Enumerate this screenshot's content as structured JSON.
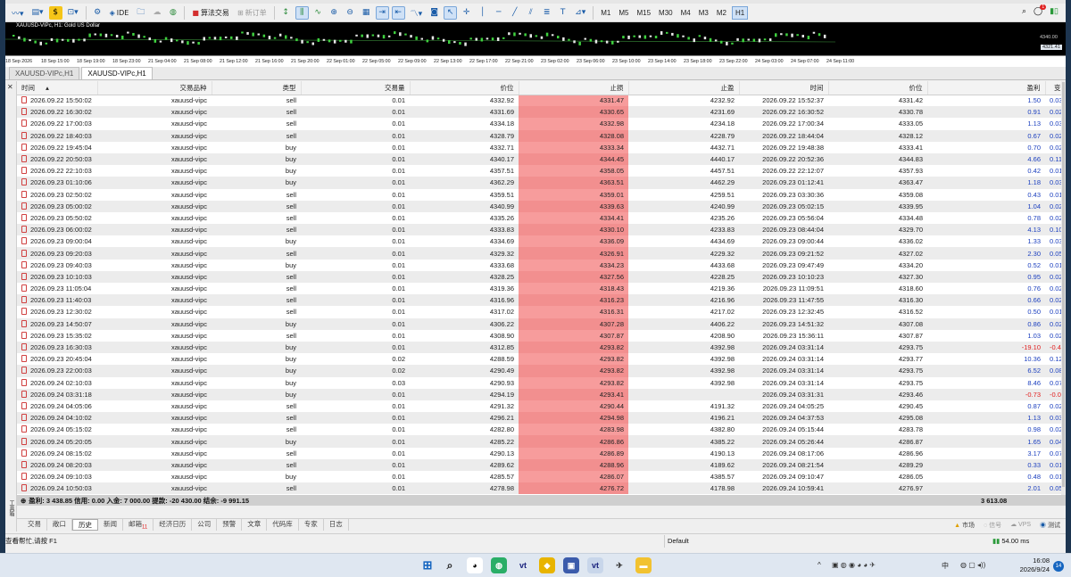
{
  "toolbar": {
    "algo_trading_label": "算法交易",
    "new_order_label": "新订单",
    "ide_label": "IDE",
    "timeframes": [
      "M1",
      "M5",
      "M15",
      "M30",
      "M4",
      "M3",
      "M2",
      "H1"
    ],
    "active_timeframe": "H1",
    "notification_count": "1"
  },
  "chart": {
    "title": "XAUUSD-VIPc, H1:  Gold US Dollar",
    "price_top": "4340.00",
    "price_tag": "4321.41",
    "time_labels": [
      "18 Sep 2026",
      "18 Sep 15:00",
      "18 Sep 19:00",
      "18 Sep 23:00",
      "21 Sep 04:00",
      "21 Sep 08:00",
      "21 Sep 12:00",
      "21 Sep 16:00",
      "21 Sep 20:00",
      "22 Sep 01:00",
      "22 Sep 05:00",
      "22 Sep 09:00",
      "22 Sep 13:00",
      "22 Sep 17:00",
      "22 Sep 21:00",
      "23 Sep 02:00",
      "23 Sep 06:00",
      "23 Sep 10:00",
      "23 Sep 14:00",
      "23 Sep 18:00",
      "23 Sep 22:00",
      "24 Sep 03:00",
      "24 Sep 07:00",
      "24 Sep 11:00"
    ]
  },
  "chart_tabs": [
    "XAUUSD-VIPc,H1",
    "XAUUSD-VIPc,H1"
  ],
  "terminal_label": "工具箱",
  "history": {
    "columns": [
      "时间",
      "交易品种",
      "类型",
      "交易量",
      "价位",
      "止损",
      "止盈",
      "时间",
      "价位",
      "盈利",
      "变"
    ],
    "rows": [
      [
        "2026.09.22 15:50:02",
        "xauusd-vipc",
        "sell",
        "0.01",
        "4332.92",
        "4331.47",
        "4232.92",
        "2026.09.22 15:52:37",
        "4331.42",
        "1.50",
        "0.03"
      ],
      [
        "2026.09.22 16:30:02",
        "xauusd-vipc",
        "sell",
        "0.01",
        "4331.69",
        "4330.65",
        "4231.69",
        "2026.09.22 16:30:52",
        "4330.78",
        "0.91",
        "0.02"
      ],
      [
        "2026.09.22 17:00:03",
        "xauusd-vipc",
        "sell",
        "0.01",
        "4334.18",
        "4332.98",
        "4234.18",
        "2026.09.22 17:00:34",
        "4333.05",
        "1.13",
        "0.03"
      ],
      [
        "2026.09.22 18:40:03",
        "xauusd-vipc",
        "sell",
        "0.01",
        "4328.79",
        "4328.08",
        "4228.79",
        "2026.09.22 18:44:04",
        "4328.12",
        "0.67",
        "0.02"
      ],
      [
        "2026.09.22 19:45:04",
        "xauusd-vipc",
        "buy",
        "0.01",
        "4332.71",
        "4333.34",
        "4432.71",
        "2026.09.22 19:48:38",
        "4333.41",
        "0.70",
        "0.02"
      ],
      [
        "2026.09.22 20:50:03",
        "xauusd-vipc",
        "buy",
        "0.01",
        "4340.17",
        "4344.45",
        "4440.17",
        "2026.09.22 20:52:36",
        "4344.83",
        "4.66",
        "0.11"
      ],
      [
        "2026.09.22 22:10:03",
        "xauusd-vipc",
        "buy",
        "0.01",
        "4357.51",
        "4358.05",
        "4457.51",
        "2026.09.22 22:12:07",
        "4357.93",
        "0.42",
        "0.01"
      ],
      [
        "2026.09.23 01:10:06",
        "xauusd-vipc",
        "buy",
        "0.01",
        "4362.29",
        "4363.51",
        "4462.29",
        "2026.09.23 01:12:41",
        "4363.47",
        "1.18",
        "0.03"
      ],
      [
        "2026.09.23 02:50:02",
        "xauusd-vipc",
        "sell",
        "0.01",
        "4359.51",
        "4359.01",
        "4259.51",
        "2026.09.23 03:30:36",
        "4359.08",
        "0.43",
        "0.01"
      ],
      [
        "2026.09.23 05:00:02",
        "xauusd-vipc",
        "sell",
        "0.01",
        "4340.99",
        "4339.63",
        "4240.99",
        "2026.09.23 05:02:15",
        "4339.95",
        "1.04",
        "0.02"
      ],
      [
        "2026.09.23 05:50:02",
        "xauusd-vipc",
        "sell",
        "0.01",
        "4335.26",
        "4334.41",
        "4235.26",
        "2026.09.23 05:56:04",
        "4334.48",
        "0.78",
        "0.02"
      ],
      [
        "2026.09.23 06:00:02",
        "xauusd-vipc",
        "sell",
        "0.01",
        "4333.83",
        "4330.10",
        "4233.83",
        "2026.09.23 08:44:04",
        "4329.70",
        "4.13",
        "0.10"
      ],
      [
        "2026.09.23 09:00:04",
        "xauusd-vipc",
        "buy",
        "0.01",
        "4334.69",
        "4336.09",
        "4434.69",
        "2026.09.23 09:00:44",
        "4336.02",
        "1.33",
        "0.03"
      ],
      [
        "2026.09.23 09:20:03",
        "xauusd-vipc",
        "sell",
        "0.01",
        "4329.32",
        "4326.91",
        "4229.32",
        "2026.09.23 09:21:52",
        "4327.02",
        "2.30",
        "0.05"
      ],
      [
        "2026.09.23 09:40:03",
        "xauusd-vipc",
        "buy",
        "0.01",
        "4333.68",
        "4334.23",
        "4433.68",
        "2026.09.23 09:47:49",
        "4334.20",
        "0.52",
        "0.01"
      ],
      [
        "2026.09.23 10:10:03",
        "xauusd-vipc",
        "sell",
        "0.01",
        "4328.25",
        "4327.56",
        "4228.25",
        "2026.09.23 10:10:23",
        "4327.30",
        "0.95",
        "0.02"
      ],
      [
        "2026.09.23 11:05:04",
        "xauusd-vipc",
        "sell",
        "0.01",
        "4319.36",
        "4318.43",
        "4219.36",
        "2026.09.23 11:09:51",
        "4318.60",
        "0.76",
        "0.02"
      ],
      [
        "2026.09.23 11:40:03",
        "xauusd-vipc",
        "sell",
        "0.01",
        "4316.96",
        "4316.23",
        "4216.96",
        "2026.09.23 11:47:55",
        "4316.30",
        "0.66",
        "0.02"
      ],
      [
        "2026.09.23 12:30:02",
        "xauusd-vipc",
        "sell",
        "0.01",
        "4317.02",
        "4316.31",
        "4217.02",
        "2026.09.23 12:32:45",
        "4316.52",
        "0.50",
        "0.01"
      ],
      [
        "2026.09.23 14:50:07",
        "xauusd-vipc",
        "buy",
        "0.01",
        "4306.22",
        "4307.28",
        "4406.22",
        "2026.09.23 14:51:32",
        "4307.08",
        "0.86",
        "0.02"
      ],
      [
        "2026.09.23 15:35:02",
        "xauusd-vipc",
        "sell",
        "0.01",
        "4308.90",
        "4307.87",
        "4208.90",
        "2026.09.23 15:36:11",
        "4307.87",
        "1.03",
        "0.02"
      ],
      [
        "2026.09.23 16:30:03",
        "xauusd-vipc",
        "buy",
        "0.01",
        "4312.85",
        "4293.82",
        "4392.98",
        "2026.09.24 03:31:14",
        "4293.75",
        "-19.10",
        "-0.44"
      ],
      [
        "2026.09.23 20:45:04",
        "xauusd-vipc",
        "buy",
        "0.02",
        "4288.59",
        "4293.82",
        "4392.98",
        "2026.09.24 03:31:14",
        "4293.77",
        "10.36",
        "0.12"
      ],
      [
        "2026.09.23 22:00:03",
        "xauusd-vipc",
        "buy",
        "0.02",
        "4290.49",
        "4293.82",
        "4392.98",
        "2026.09.24 03:31:14",
        "4293.75",
        "6.52",
        "0.08"
      ],
      [
        "2026.09.24 02:10:03",
        "xauusd-vipc",
        "buy",
        "0.03",
        "4290.93",
        "4293.82",
        "4392.98",
        "2026.09.24 03:31:14",
        "4293.75",
        "8.46",
        "0.07"
      ],
      [
        "2026.09.24 03:31:18",
        "xauusd-vipc",
        "buy",
        "0.01",
        "4294.19",
        "4293.41",
        "",
        "2026.09.24 03:31:31",
        "4293.46",
        "-0.73",
        "-0.02"
      ],
      [
        "2026.09.24 04:05:06",
        "xauusd-vipc",
        "sell",
        "0.01",
        "4291.32",
        "4290.44",
        "4191.32",
        "2026.09.24 04:05:25",
        "4290.45",
        "0.87",
        "0.02"
      ],
      [
        "2026.09.24 04:10:02",
        "xauusd-vipc",
        "sell",
        "0.01",
        "4296.21",
        "4294.98",
        "4196.21",
        "2026.09.24 04:37:53",
        "4295.08",
        "1.13",
        "0.03"
      ],
      [
        "2026.09.24 05:15:02",
        "xauusd-vipc",
        "sell",
        "0.01",
        "4282.80",
        "4283.98",
        "4382.80",
        "2026.09.24 05:15:44",
        "4283.78",
        "0.98",
        "0.02"
      ],
      [
        "2026.09.24 05:20:05",
        "xauusd-vipc",
        "buy",
        "0.01",
        "4285.22",
        "4286.86",
        "4385.22",
        "2026.09.24 05:26:44",
        "4286.87",
        "1.65",
        "0.04"
      ],
      [
        "2026.09.24 08:15:02",
        "xauusd-vipc",
        "sell",
        "0.01",
        "4290.13",
        "4286.89",
        "4190.13",
        "2026.09.24 08:17:06",
        "4286.96",
        "3.17",
        "0.07"
      ],
      [
        "2026.09.24 08:20:03",
        "xauusd-vipc",
        "sell",
        "0.01",
        "4289.62",
        "4288.96",
        "4189.62",
        "2026.09.24 08:21:54",
        "4289.29",
        "0.33",
        "0.01"
      ],
      [
        "2026.09.24 09:10:03",
        "xauusd-vipc",
        "buy",
        "0.01",
        "4285.57",
        "4286.07",
        "4385.57",
        "2026.09.24 09:10:47",
        "4286.05",
        "0.48",
        "0.01"
      ],
      [
        "2026.09.24 10:50:03",
        "xauusd-vipc",
        "sell",
        "0.01",
        "4278.98",
        "4276.72",
        "4178.98",
        "2026.09.24 10:59:41",
        "4276.97",
        "2.01",
        "0.05"
      ]
    ],
    "summary": "盈利: 3 438.85  信用: 0.00  入金: 7 000.00  提款: -20 430.00  结余: -9 991.15",
    "summary_total": "3 613.08"
  },
  "bottom_tabs": [
    {
      "label": "交易"
    },
    {
      "label": "敞口"
    },
    {
      "label": "历史",
      "active": true
    },
    {
      "label": "新闻"
    },
    {
      "label": "邮箱",
      "badge": "11"
    },
    {
      "label": "经济日历"
    },
    {
      "label": "公司"
    },
    {
      "label": "预警"
    },
    {
      "label": "文章"
    },
    {
      "label": "代码库"
    },
    {
      "label": "专家"
    },
    {
      "label": "日志"
    }
  ],
  "bottom_right": {
    "market": "市场",
    "signals": "信号",
    "vps": "VPS",
    "tester": "测试"
  },
  "status": {
    "help": "查看帮忙,请按 F1",
    "profile": "Default",
    "ping": "54.00 ms"
  },
  "taskbar": {
    "time": "16:08",
    "date": "2026/9/24",
    "ime": "中",
    "notif": "14"
  },
  "colors": {
    "stoploss_cell": "#f79c9c",
    "profit_pos": "#1b3fbf",
    "profit_neg": "#e12020",
    "chart_bg": "#000000"
  }
}
